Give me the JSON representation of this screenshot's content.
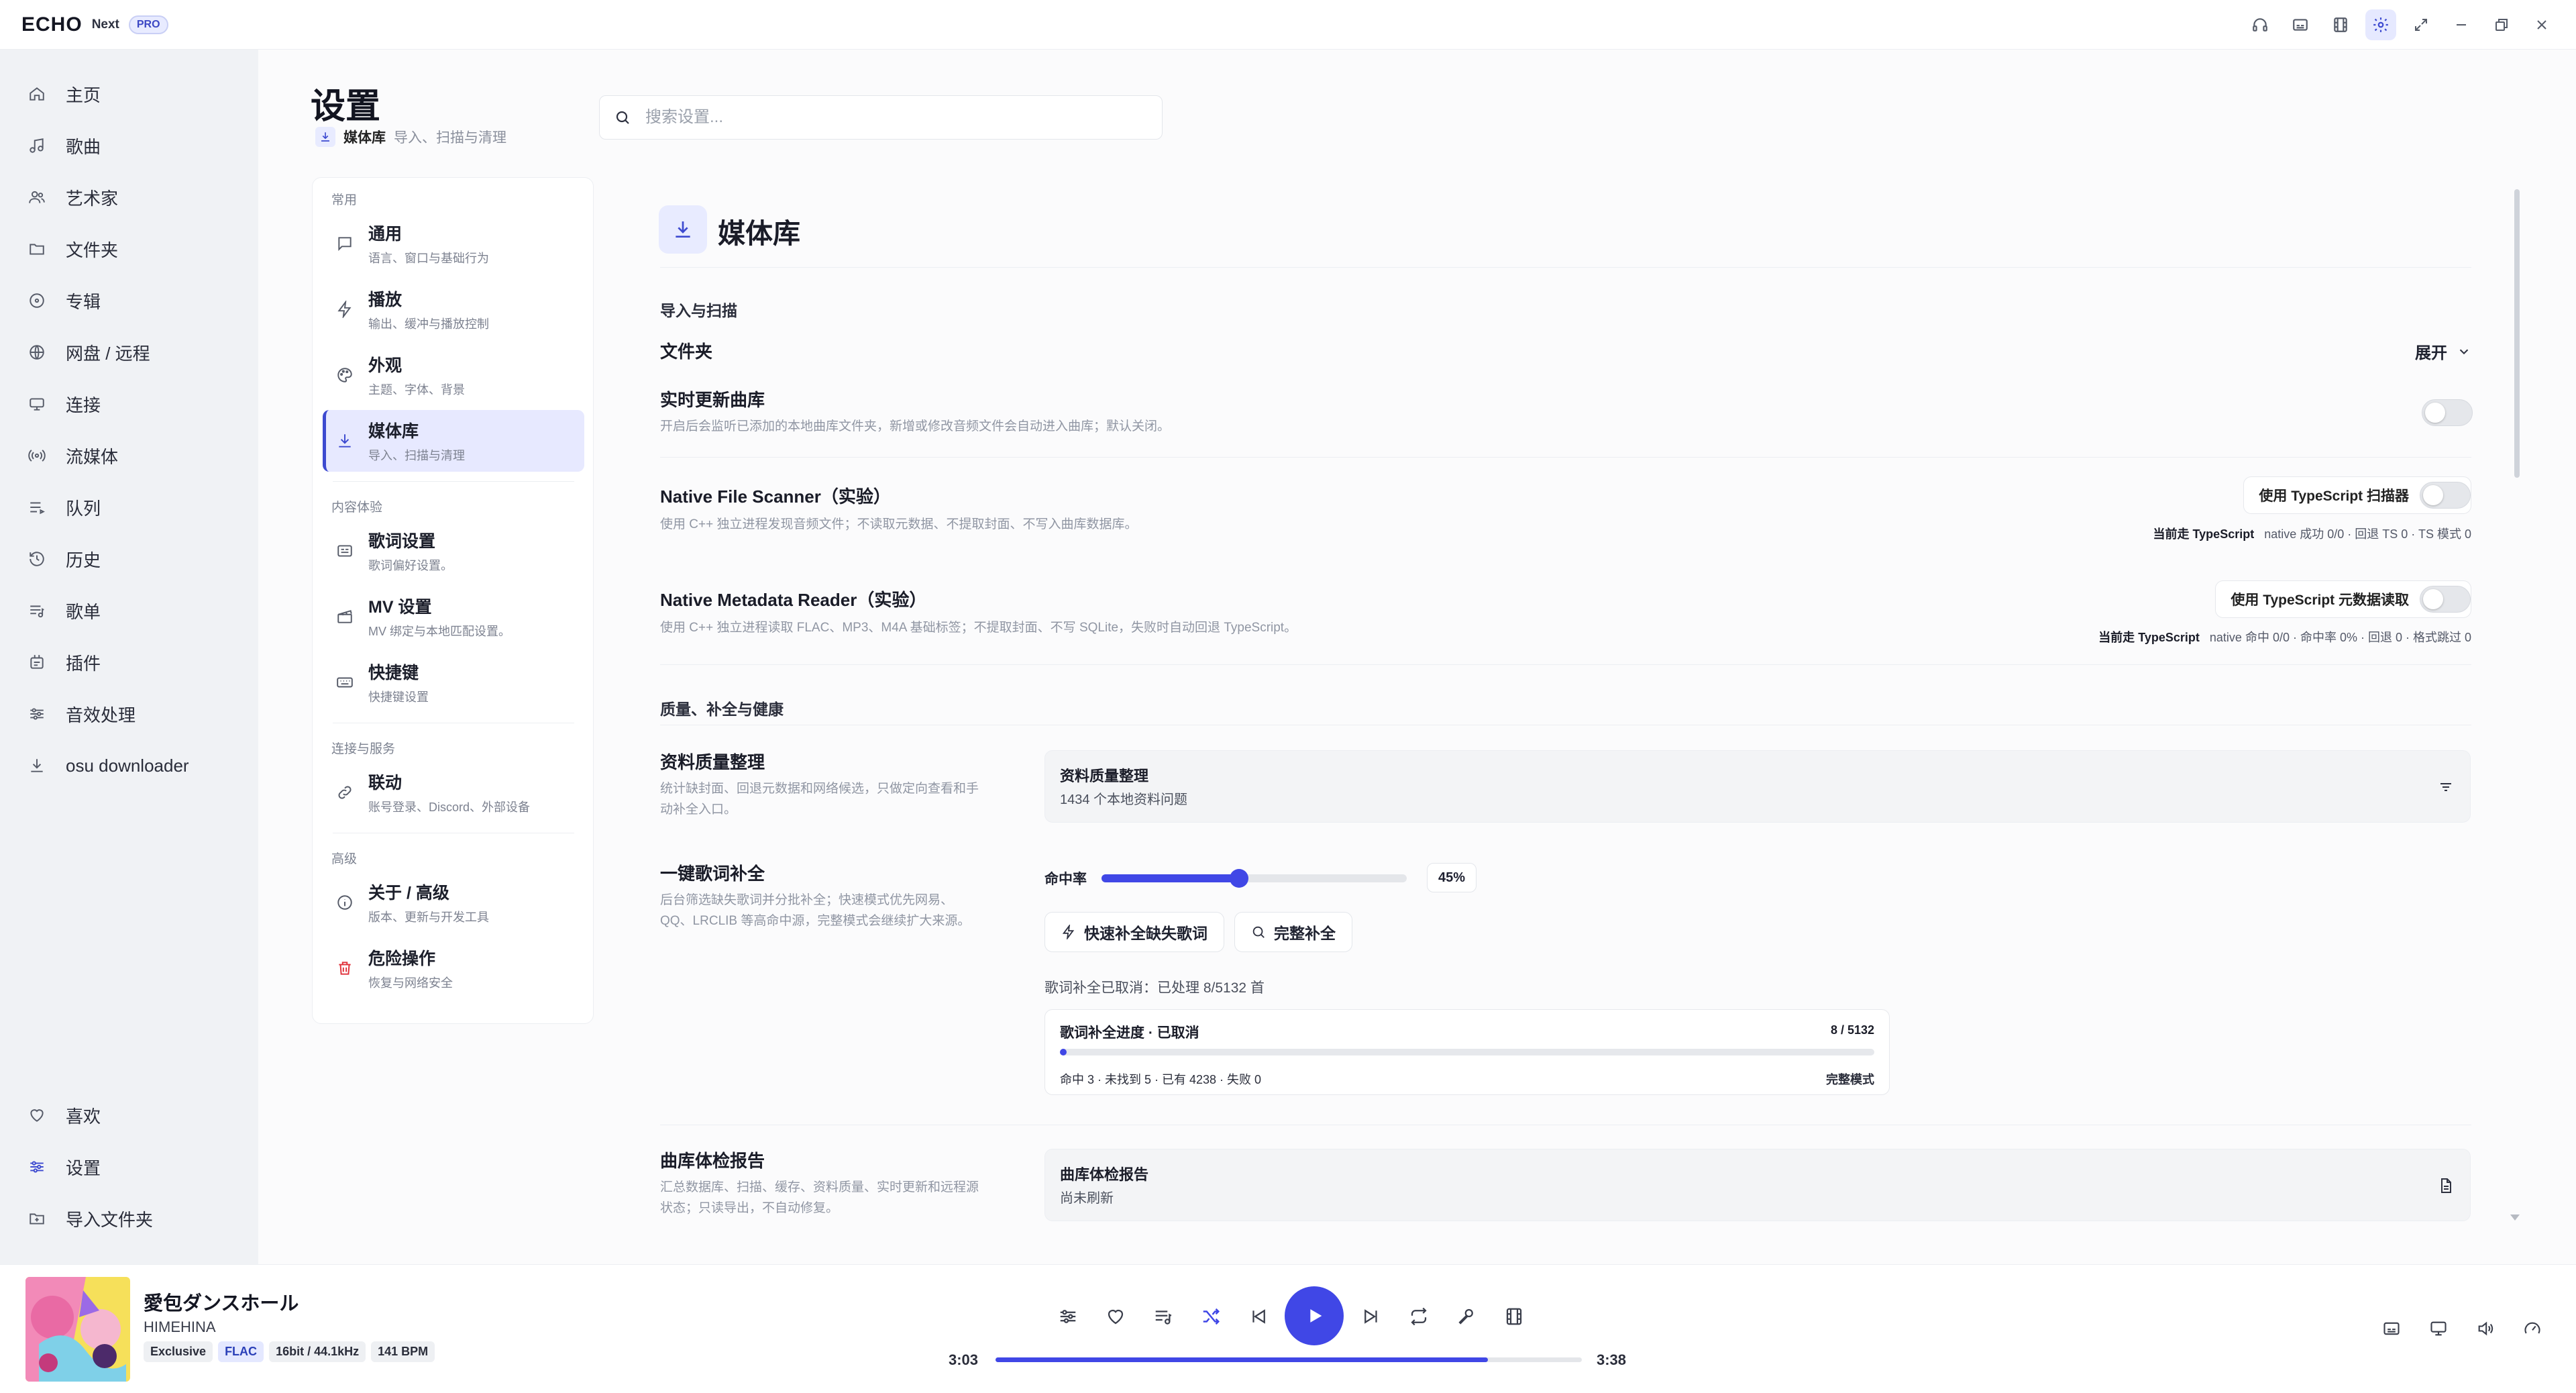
{
  "app": {
    "logo": "ECHO",
    "edition": "Next",
    "badge": "PRO"
  },
  "window_controls": [
    {
      "icon": "headphones-icon"
    },
    {
      "icon": "subtitles-icon"
    },
    {
      "icon": "film-icon"
    },
    {
      "icon": "gear-icon",
      "active": true
    },
    {
      "icon": "expand-icon"
    },
    {
      "icon": "minimize-icon"
    },
    {
      "icon": "restore-icon"
    },
    {
      "icon": "close-icon"
    }
  ],
  "sidebar": {
    "items": [
      {
        "label": "主页",
        "icon": "home-icon"
      },
      {
        "label": "歌曲",
        "icon": "music-note-icon"
      },
      {
        "label": "艺术家",
        "icon": "users-icon"
      },
      {
        "label": "文件夹",
        "icon": "folder-icon"
      },
      {
        "label": "专辑",
        "icon": "disc-icon"
      },
      {
        "label": "网盘 / 远程",
        "icon": "globe-icon"
      },
      {
        "label": "连接",
        "icon": "cast-icon"
      },
      {
        "label": "流媒体",
        "icon": "broadcast-icon"
      },
      {
        "label": "队列",
        "icon": "queue-icon"
      },
      {
        "label": "历史",
        "icon": "history-icon"
      },
      {
        "label": "歌单",
        "icon": "playlist-icon"
      },
      {
        "label": "插件",
        "icon": "plugin-icon"
      },
      {
        "label": "音效处理",
        "icon": "equalizer-icon"
      },
      {
        "label": "osu downloader",
        "icon": "download-icon"
      }
    ],
    "bottom": [
      {
        "label": "喜欢",
        "icon": "heart-icon"
      },
      {
        "label": "设置",
        "icon": "settings-sliders-icon"
      },
      {
        "label": "导入文件夹",
        "icon": "folder-import-icon"
      }
    ]
  },
  "page": {
    "title": "设置",
    "crumb_title": "媒体库",
    "crumb_desc": "导入、扫描与清理",
    "search_placeholder": "搜索设置..."
  },
  "categories": {
    "sections": [
      "常用",
      "内容体验",
      "连接与服务",
      "高级"
    ],
    "items": [
      {
        "title": "通用",
        "desc": "语言、窗口与基础行为",
        "icon": "chat-icon"
      },
      {
        "title": "播放",
        "desc": "输出、缓冲与播放控制",
        "icon": "bolt-icon"
      },
      {
        "title": "外观",
        "desc": "主题、字体、背景",
        "icon": "palette-icon"
      },
      {
        "title": "媒体库",
        "desc": "导入、扫描与清理",
        "icon": "download-icon",
        "active": true
      },
      {
        "title": "歌词设置",
        "desc": "歌词偏好设置。",
        "icon": "lyrics-icon"
      },
      {
        "title": "MV 设置",
        "desc": "MV 绑定与本地匹配设置。",
        "icon": "clapper-icon"
      },
      {
        "title": "快捷键",
        "desc": "快捷键设置",
        "icon": "keyboard-icon"
      },
      {
        "title": "联动",
        "desc": "账号登录、Discord、外部设备",
        "icon": "link-icon"
      },
      {
        "title": "关于 / 高级",
        "desc": "版本、更新与开发工具",
        "icon": "info-icon"
      },
      {
        "title": "危险操作",
        "desc": "恢复与网络安全",
        "icon": "trash-icon",
        "danger": true
      }
    ]
  },
  "panel": {
    "title": "媒体库",
    "group_import": "导入与扫描",
    "folder": {
      "title": "文件夹",
      "action": "展开"
    },
    "realtime": {
      "title": "实时更新曲库",
      "desc": "开启后会监听已添加的本地曲库文件夹，新增或修改音频文件会自动进入曲库；默认关闭。",
      "enabled": false
    },
    "native_scanner": {
      "title": "Native File Scanner（实验）",
      "desc": "使用 C++ 独立进程发现音频文件；不读取元数据、不提取封面、不写入曲库数据库。",
      "pill": "使用 TypeScript 扫描器",
      "status_label": "当前走 TypeScript",
      "status_text": "native 成功 0/0 · 回退 TS 0 · TS 模式 0"
    },
    "native_reader": {
      "title": "Native Metadata Reader（实验）",
      "desc": "使用 C++ 独立进程读取 FLAC、MP3、M4A 基础标签；不提取封面、不写 SQLite，失败时自动回退 TypeScript。",
      "pill": "使用 TypeScript 元数据读取",
      "status_label": "当前走 TypeScript",
      "status_text": "native 命中 0/0 · 命中率 0% · 回退 0 · 格式跳过 0"
    },
    "group_quality": "质量、补全与健康",
    "quality": {
      "title": "资料质量整理",
      "desc": [
        "统计缺封面、回退元数据和网络候选，只做定向查看和手",
        "动补全入口。"
      ],
      "card_title": "资料质量整理",
      "card_sub": "1434 个本地资料问题"
    },
    "lyrics_fill": {
      "title": "一键歌词补全",
      "desc": [
        "后台筛选缺失歌词并分批补全；快速模式优先网易、",
        "QQ、LRCLIB 等高命中源，完整模式会继续扩大来源。"
      ],
      "hit_label": "命中率",
      "hit_value": "45%",
      "hit_fraction": 0.45,
      "btn_quick": "快速补全缺失歌词",
      "btn_full": "完整补全",
      "cancel_note": "歌词补全已取消：已处理 8/5132 首",
      "progress_title": "歌词补全进度 · 已取消",
      "progress_count": "8 / 5132",
      "progress_fraction": 0.0016,
      "progress_detail": "命中 3 · 未找到 5 · 已有 4238 · 失败 0",
      "progress_mode": "完整模式"
    },
    "health": {
      "title": "曲库体检报告",
      "desc": [
        "汇总数据库、扫描、缓存、资料质量、实时更新和远程源",
        "状态；只读导出，不自动修复。"
      ],
      "card_title": "曲库体检报告",
      "card_sub": "尚未刷新"
    }
  },
  "player": {
    "title": "愛包ダンスホール",
    "artist": "HIMEHINA",
    "tags": [
      "Exclusive",
      "FLAC",
      "16bit / 44.1kHz",
      "141 BPM"
    ],
    "elapsed": "3:03",
    "duration": "3:38",
    "progress_fraction": 0.84,
    "accent": "#4047e6"
  }
}
